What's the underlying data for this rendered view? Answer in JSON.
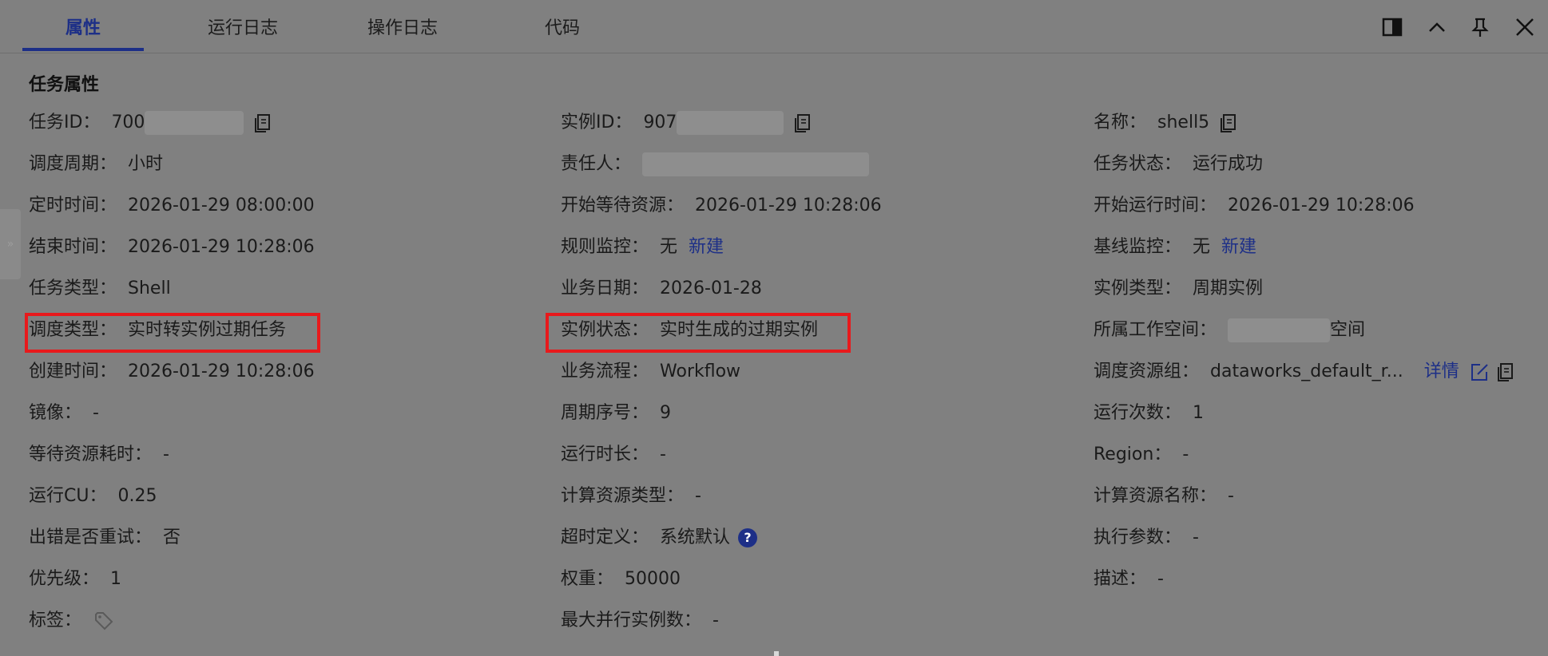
{
  "tabs": [
    {
      "label": "属性"
    },
    {
      "label": "运行日志"
    },
    {
      "label": "操作日志"
    },
    {
      "label": "代码"
    }
  ],
  "toolbar": {
    "split_icon": "split-panel-icon",
    "collapse_icon": "chevron-up-icon",
    "pin_icon": "pin-icon",
    "close_icon": "close-icon"
  },
  "side_handle": "»",
  "section": {
    "title": "任务属性"
  },
  "col1": {
    "task_id": {
      "label": "任务ID：",
      "value": "700"
    },
    "schedule_cycle": {
      "label": "调度周期：",
      "value": "小时"
    },
    "scheduled_time": {
      "label": "定时时间：",
      "value": "2026-01-29 08:00:00"
    },
    "end_time": {
      "label": "结束时间：",
      "value": "2026-01-29 10:28:06"
    },
    "task_type": {
      "label": "任务类型：",
      "value": "Shell"
    },
    "schedule_type": {
      "label": "调度类型：",
      "value": "实时转实例过期任务"
    },
    "create_time": {
      "label": "创建时间：",
      "value": "2026-01-29 10:28:06"
    },
    "image": {
      "label": "镜像：",
      "value": "-"
    },
    "wait_cost": {
      "label": "等待资源耗时：",
      "value": "-"
    },
    "run_cu": {
      "label": "运行CU：",
      "value": "0.25"
    },
    "retry_on_error": {
      "label": "出错是否重试：",
      "value": "否"
    },
    "priority": {
      "label": "优先级：",
      "value": "1"
    },
    "tags": {
      "label": "标签："
    }
  },
  "col2": {
    "instance_id": {
      "label": "实例ID：",
      "value": "907"
    },
    "owner": {
      "label": "责任人："
    },
    "wait_start": {
      "label": "开始等待资源：",
      "value": "2026-01-29 10:28:06"
    },
    "rule_monitor": {
      "label": "规则监控：",
      "value": "无",
      "link": "新建"
    },
    "biz_date": {
      "label": "业务日期：",
      "value": "2026-01-28"
    },
    "instance_status": {
      "label": "实例状态：",
      "value": "实时生成的过期实例"
    },
    "biz_flow": {
      "label": "业务流程：",
      "value": "Workflow"
    },
    "cycle_seq": {
      "label": "周期序号：",
      "value": "9"
    },
    "run_duration": {
      "label": "运行时长：",
      "value": "-"
    },
    "compute_type": {
      "label": "计算资源类型：",
      "value": "-"
    },
    "timeout": {
      "label": "超时定义：",
      "value": "系统默认",
      "help": "?"
    },
    "weight": {
      "label": "权重：",
      "value": "50000"
    },
    "max_parallel": {
      "label": "最大并行实例数：",
      "value": "-"
    }
  },
  "col3": {
    "name": {
      "label": "名称：",
      "value": "shell5"
    },
    "task_status": {
      "label": "任务状态：",
      "value": "运行成功"
    },
    "run_start": {
      "label": "开始运行时间：",
      "value": "2026-01-29 10:28:06"
    },
    "baseline_monitor": {
      "label": "基线监控：",
      "value": "无",
      "link": "新建"
    },
    "instance_type": {
      "label": "实例类型：",
      "value": "周期实例"
    },
    "workspace": {
      "label": "所属工作空间：",
      "value": "空间"
    },
    "resource_group": {
      "label": "调度资源组：",
      "value": "dataworks_default_r...",
      "link": "详情"
    },
    "run_count": {
      "label": "运行次数：",
      "value": "1"
    },
    "region": {
      "label": "Region：",
      "value": "-"
    },
    "compute_name": {
      "label": "计算资源名称：",
      "value": "-"
    },
    "exec_params": {
      "label": "执行参数：",
      "value": "-"
    },
    "description": {
      "label": "描述：",
      "value": "-"
    }
  },
  "colors": {
    "overlay_bg": "#808080",
    "accent": "#1d2f87",
    "highlight": "#e8191c"
  }
}
